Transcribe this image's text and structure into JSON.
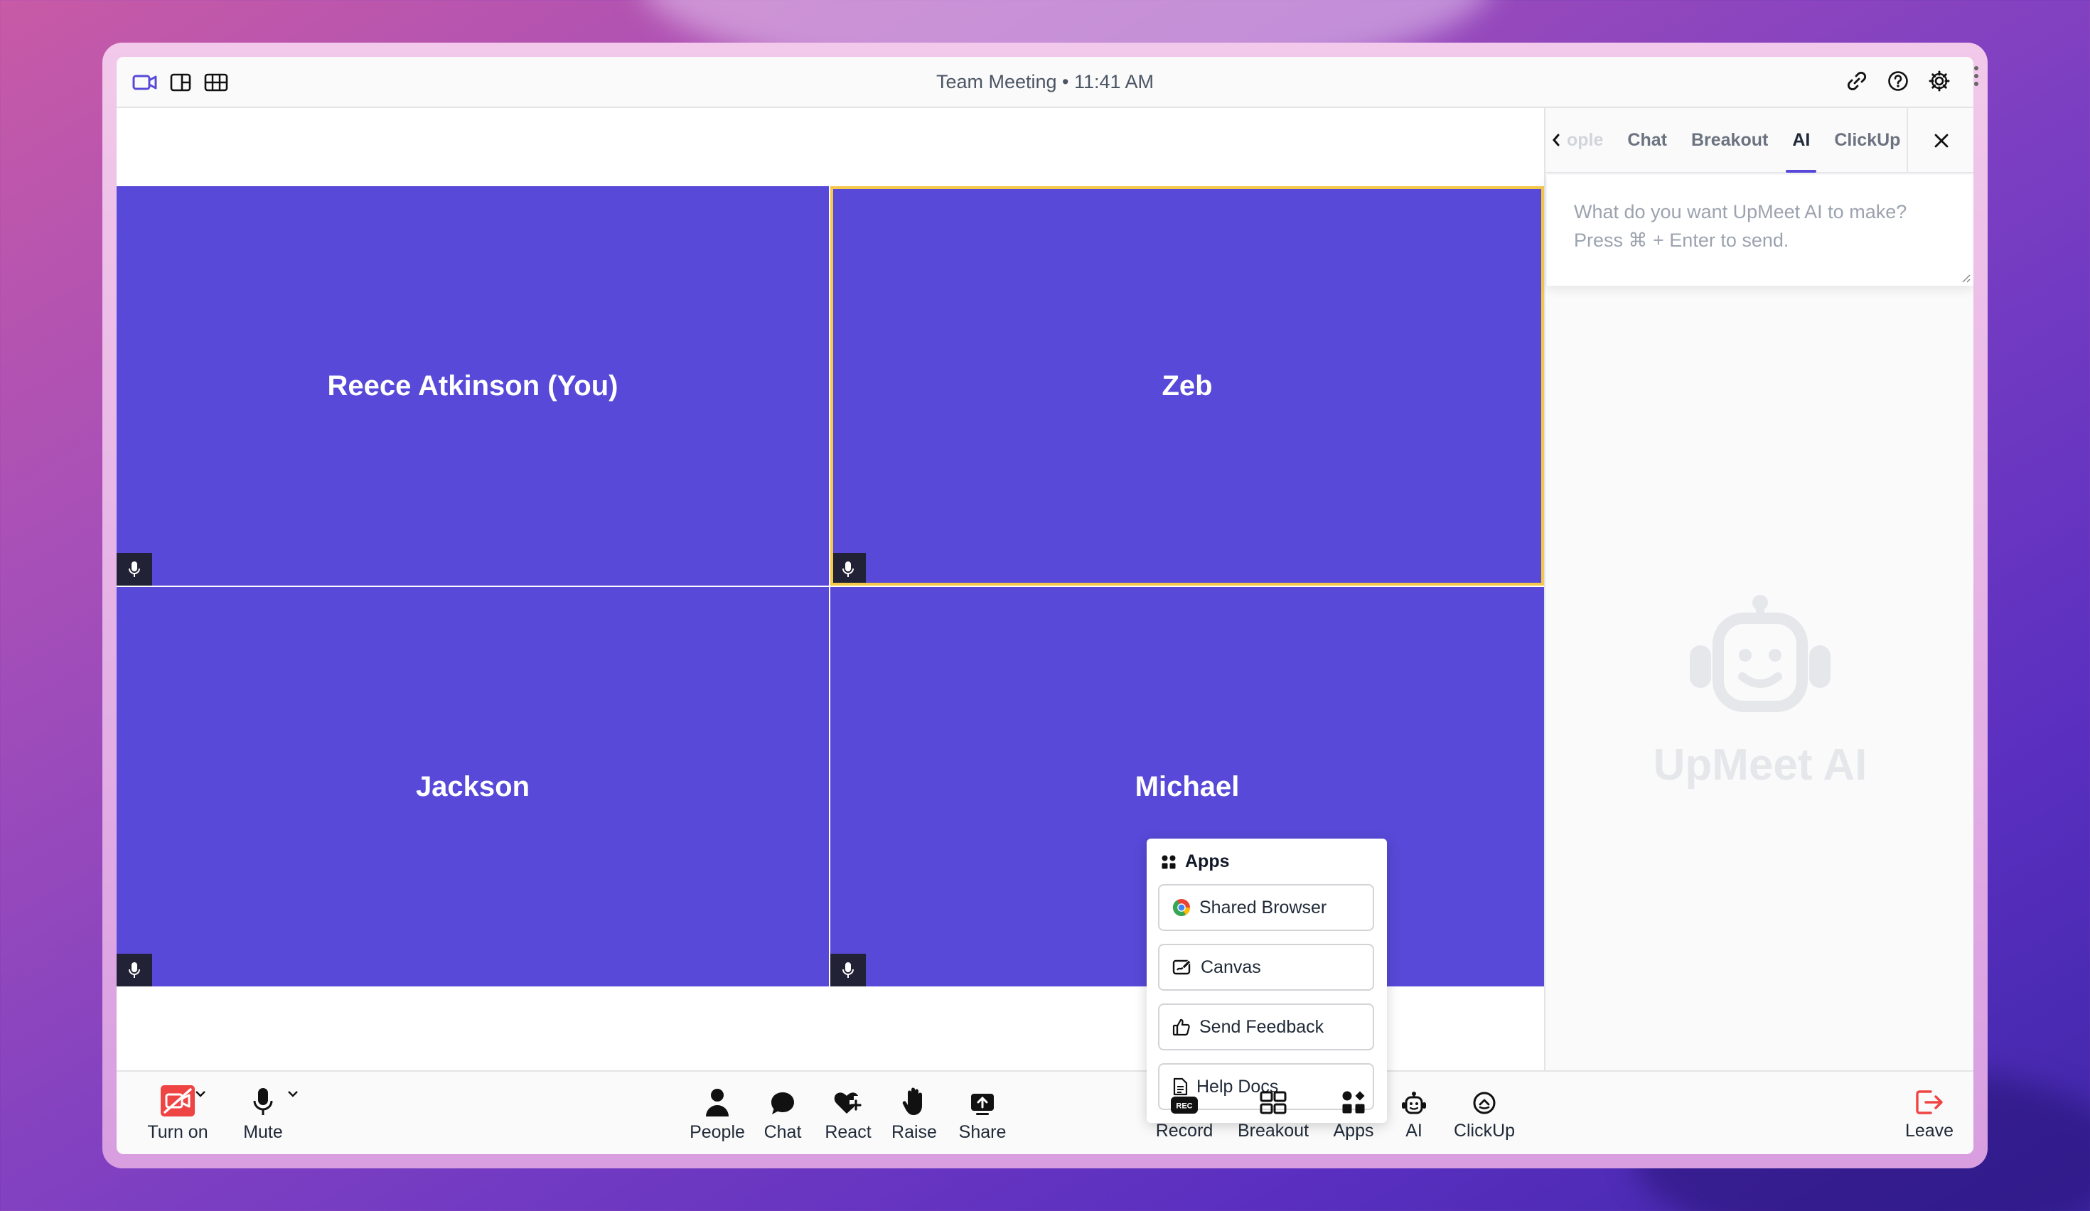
{
  "window": {
    "title": "Team Meeting • 11:41 AM"
  },
  "titlebar": {
    "left_icons": [
      "video-layout-icon",
      "sidebar-layout-icon",
      "grid-layout-icon"
    ],
    "right_icons": [
      "link-icon",
      "help-icon",
      "settings-icon"
    ]
  },
  "tiles": [
    {
      "name": "Reece Atkinson (You)"
    },
    {
      "name": "Zeb",
      "active_speaker": true
    },
    {
      "name": "Jackson"
    },
    {
      "name": "Michael"
    }
  ],
  "sidepanel": {
    "tabs": [
      {
        "label": "ople",
        "faded": true
      },
      {
        "label": "Chat"
      },
      {
        "label": "Breakout"
      },
      {
        "label": "AI",
        "active": true
      },
      {
        "label": "ClickUp"
      }
    ],
    "prompt_placeholder": "What do you want UpMeet AI to make?\nPress ⌘ + Enter to send.",
    "empty_state_label": "UpMeet AI"
  },
  "apps_popover": {
    "title": "Apps",
    "items": [
      {
        "label": "Shared Browser",
        "icon": "chrome-icon"
      },
      {
        "label": "Canvas",
        "icon": "canvas-icon"
      },
      {
        "label": "Send Feedback",
        "icon": "thumbs-up-icon"
      },
      {
        "label": "Help Docs",
        "icon": "document-icon"
      }
    ]
  },
  "toolbar": {
    "camera": {
      "label": "Turn on",
      "icon": "camera-off-icon"
    },
    "mic": {
      "label": "Mute",
      "icon": "microphone-icon"
    },
    "center": [
      {
        "label": "People",
        "icon": "people-icon"
      },
      {
        "label": "Chat",
        "icon": "chat-icon"
      },
      {
        "label": "React",
        "icon": "react-icon"
      },
      {
        "label": "Raise",
        "icon": "hand-icon"
      },
      {
        "label": "Share",
        "icon": "share-icon"
      },
      {
        "label": "Record",
        "icon": "record-icon",
        "badge": "REC"
      },
      {
        "label": "Breakout",
        "icon": "breakout-icon"
      },
      {
        "label": "Apps",
        "icon": "apps-icon"
      },
      {
        "label": "AI",
        "icon": "robot-icon"
      },
      {
        "label": "ClickUp",
        "icon": "clickup-icon"
      }
    ],
    "leave": {
      "label": "Leave",
      "icon": "leave-icon"
    }
  },
  "colors": {
    "tile": "#5849d8",
    "active_border": "#f4c84a",
    "accent": "#5849d8",
    "danger": "#ef4444"
  }
}
